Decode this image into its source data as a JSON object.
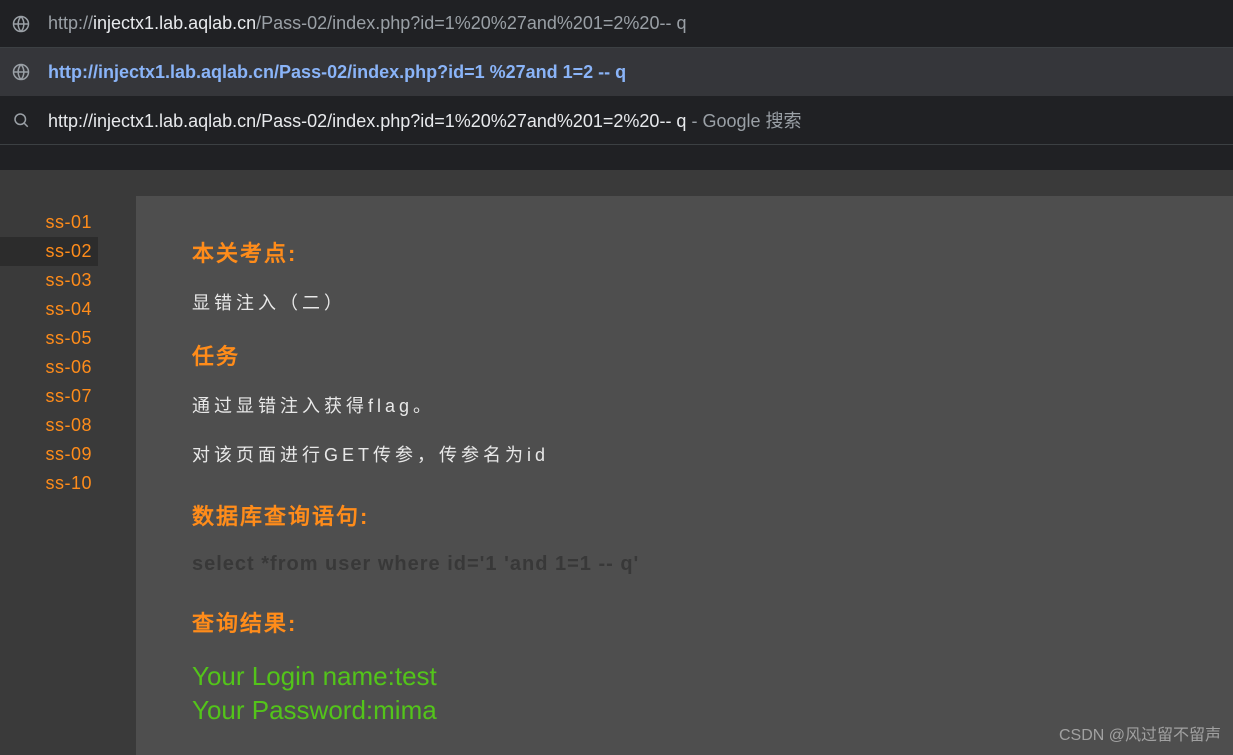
{
  "addressbar": {
    "prefix": "http://",
    "host": "injectx1.lab.aqlab.cn",
    "path": "/Pass-02/index.php?id=1%20%27and%201=2%20-- q"
  },
  "suggestions": [
    {
      "type": "url",
      "selected": true,
      "text": "http://injectx1.lab.aqlab.cn/Pass-02/index.php?id=1 %27and 1=2 -- q"
    },
    {
      "type": "search",
      "selected": false,
      "text": "http://injectx1.lab.aqlab.cn/Pass-02/index.php?id=1%20%27and%201=2%20-- q",
      "suffix": " - Google 搜索"
    }
  ],
  "sidebar": {
    "items": [
      {
        "label": "ss-01"
      },
      {
        "label": "ss-02"
      },
      {
        "label": "ss-03"
      },
      {
        "label": "ss-04"
      },
      {
        "label": "ss-05"
      },
      {
        "label": "ss-06"
      },
      {
        "label": "ss-07"
      },
      {
        "label": "ss-08"
      },
      {
        "label": "ss-09"
      },
      {
        "label": "ss-10"
      }
    ],
    "active_index": 1
  },
  "content": {
    "heading1": "本关考点:",
    "text1": "显错注入（二）",
    "heading2": "任务",
    "text2": "通过显错注入获得flag。",
    "text3": "对该页面进行GET传参，传参名为id",
    "heading3": "数据库查询语句:",
    "query": "select *from user where id='1 'and 1=1 -- q'",
    "heading4": "查询结果:",
    "result_login": "Your Login name:test",
    "result_password": "Your Password:mima"
  },
  "watermark": "CSDN @风过留不留声"
}
